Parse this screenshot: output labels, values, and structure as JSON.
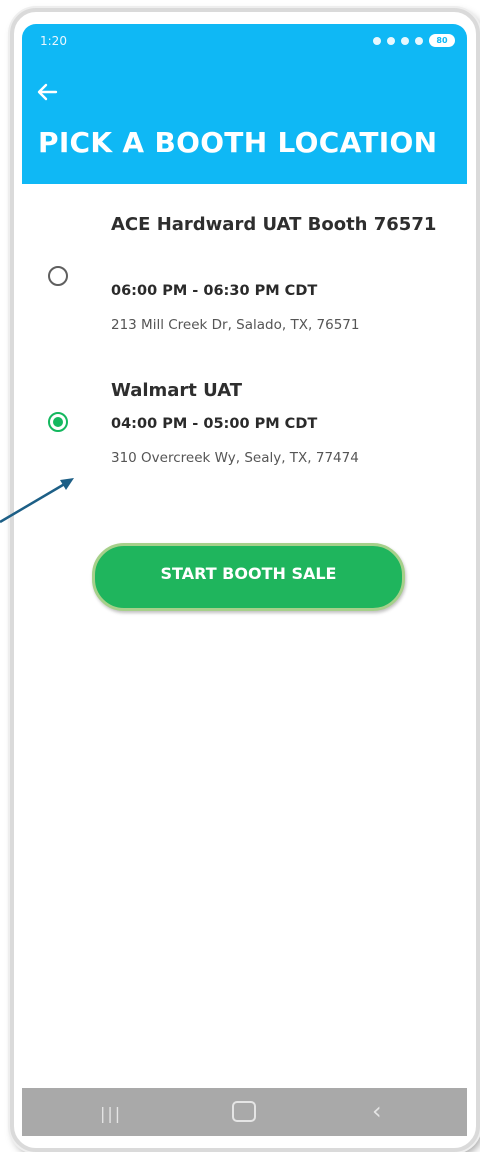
{
  "status_bar": {
    "time": "1:20",
    "battery": "80"
  },
  "header": {
    "back_icon": "arrow-left-icon",
    "title": "PICK A BOOTH LOCATION",
    "background": "#0fb8f5"
  },
  "booths": [
    {
      "name": "ACE Hardward UAT Booth 76571",
      "time": "06:00 PM - 06:30 PM CDT",
      "address": "213 Mill Creek Dr, Salado, TX, 76571",
      "selected": false
    },
    {
      "name": "Walmart UAT",
      "time": "04:00 PM - 05:00 PM CDT",
      "address": "310 Overcreek Wy, Sealy, TX, 77474",
      "selected": true
    }
  ],
  "actions": {
    "start_label": "START BOOTH SALE",
    "accent": "#1fb55d"
  },
  "navbar": {
    "recent_icon": "recent-apps-icon",
    "home_icon": "home-icon",
    "back_icon": "back-chevron-icon"
  }
}
